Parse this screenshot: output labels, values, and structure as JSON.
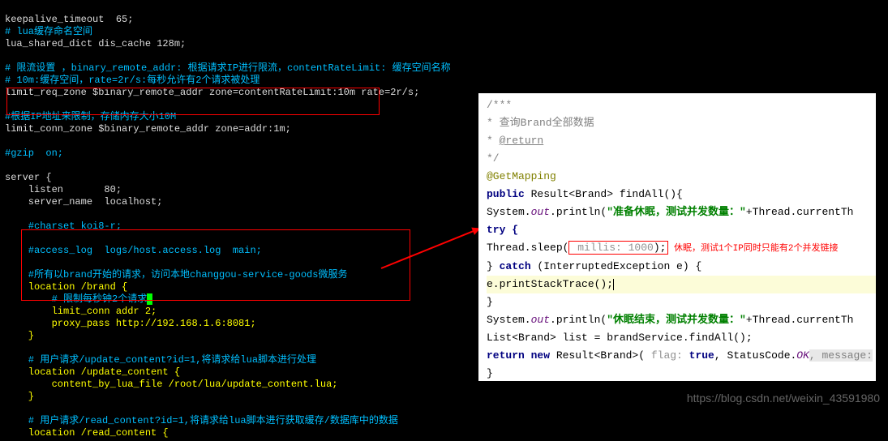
{
  "terminal": {
    "l1": "keepalive_timeout  65;",
    "l2": "# lua缓存命名空间",
    "l3": "lua_shared_dict dis_cache 128m;",
    "l4": "# 限流设置 ，binary_remote_addr: 根据请求IP进行限流，contentRateLimit: 缓存空间名称",
    "l5": "# 10m:缓存空间，rate=2r/s:每秒允许有2个请求被处理",
    "l6": "limit_req_zone $binary_remote_addr zone=contentRateLimit:10m rate=2r/s;",
    "l7": "#根据IP地址来限制，存储内存大小10M",
    "l8": "limit_conn_zone $binary_remote_addr zone=addr:1m;",
    "l9": "#gzip  on;",
    "l10": "server {",
    "l11": "    listen       80;",
    "l12": "    server_name  localhost;",
    "l13": "    #charset koi8-r;",
    "l14": "    #access_log  logs/host.access.log  main;",
    "l15": "    #所有以brand开始的请求，访问本地changgou-service-goods微服务",
    "l16": "    location /brand {",
    "l17a": "        # 限制每秒钟2个请求",
    "l17b": " ",
    "l18": "        limit_conn addr 2;",
    "l19": "        proxy_pass http://192.168.1.6:8081;",
    "l20": "    }",
    "l21": "    # 用户请求/update_content?id=1,将请求给lua脚本进行处理",
    "l22": "    location /update_content {",
    "l23": "        content_by_lua_file /root/lua/update_content.lua;",
    "l24": "    }",
    "l25": "    # 用户请求/read_content?id=1,将请求给lua脚本进行获取缓存/数据库中的数据",
    "l26": "    location /read_content {"
  },
  "ide": {
    "c1": " /***",
    "c2": "  * 查询Brand全部数据",
    "c3a": "  * ",
    "c3b": "@return",
    "c4": "  */",
    "anno": "@GetMapping",
    "kw_public": "public",
    "ret_type": " Result<Brand> findAll(){",
    "sop1a": "    System.",
    "out": "out",
    "sop1b": ".println(",
    "str1": "\"准备休眠，测试并发数量：\"",
    "sop1c": "+Thread.currentTh",
    "try": "    try {",
    "sleep1": "        Thread.sleep(",
    "millis": " millis: 1000",
    "sleep2": ");",
    "sleep_comment": "  休眠，测试1个IP同时只能有2个并发链接",
    "catch1": "    } ",
    "catch_kw": "catch",
    "catch2": " (InterruptedException e) {",
    "stack": "        e.printStackTrace();",
    "closebr": "    }",
    "sop2a": "    System.",
    "sop2b": ".println(",
    "str2": "\"休眠结束，测试并发数量：\"",
    "sop2c": "+Thread.currentTh",
    "list": "    List<Brand> list = brandService.findAll();",
    "ret1": "    ",
    "ret_kw": "return new",
    "ret2": " Result<Brand>(",
    "flag": " flag: ",
    "true_kw": "true",
    "comma": ", StatusCode.",
    "ok": "OK",
    "msg": ", message: ",
    "end": "}"
  },
  "watermark": "https://blog.csdn.net/weixin_43591980"
}
